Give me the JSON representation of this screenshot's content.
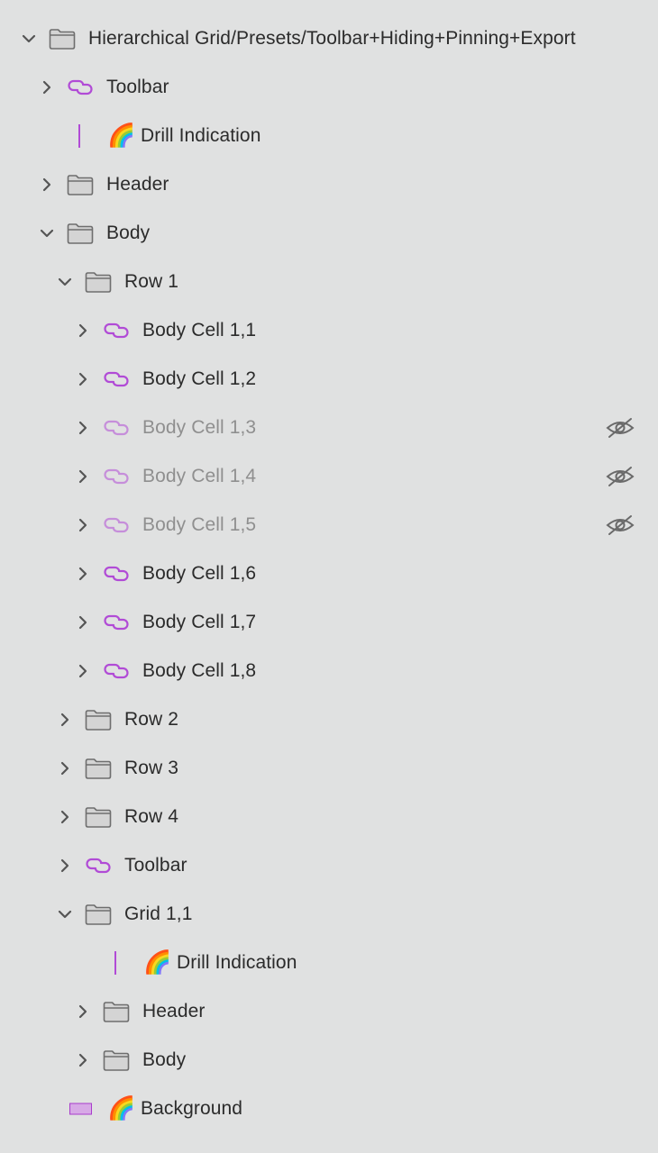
{
  "layers": [
    {
      "label": "Hierarchical Grid/Presets/Toolbar+Hiding+Pinning+Export",
      "icon": "folder-icon",
      "depth": 0,
      "expander": "expanded",
      "hidden": false
    },
    {
      "label": "Toolbar",
      "icon": "component-instance-icon",
      "depth": 1,
      "expander": "collapsed",
      "hidden": false
    },
    {
      "label": "Drill Indication",
      "icon": "rainbow-icon",
      "depth": 1,
      "expander": "none",
      "marker": "line",
      "hidden": false
    },
    {
      "label": "Header",
      "icon": "folder-icon",
      "depth": 1,
      "expander": "collapsed",
      "hidden": false
    },
    {
      "label": "Body",
      "icon": "folder-icon",
      "depth": 1,
      "expander": "expanded",
      "hidden": false
    },
    {
      "label": "Row 1",
      "icon": "folder-icon",
      "depth": 2,
      "expander": "expanded",
      "hidden": false
    },
    {
      "label": "Body Cell 1,1",
      "icon": "component-instance-icon",
      "depth": 3,
      "expander": "collapsed",
      "hidden": false
    },
    {
      "label": "Body Cell 1,2",
      "icon": "component-instance-icon",
      "depth": 3,
      "expander": "collapsed",
      "hidden": false
    },
    {
      "label": "Body Cell 1,3",
      "icon": "component-instance-icon",
      "depth": 3,
      "expander": "collapsed",
      "hidden": true
    },
    {
      "label": "Body Cell 1,4",
      "icon": "component-instance-icon",
      "depth": 3,
      "expander": "collapsed",
      "hidden": true
    },
    {
      "label": "Body Cell 1,5",
      "icon": "component-instance-icon",
      "depth": 3,
      "expander": "collapsed",
      "hidden": true
    },
    {
      "label": "Body Cell 1,6",
      "icon": "component-instance-icon",
      "depth": 3,
      "expander": "collapsed",
      "hidden": false
    },
    {
      "label": "Body Cell 1,7",
      "icon": "component-instance-icon",
      "depth": 3,
      "expander": "collapsed",
      "hidden": false
    },
    {
      "label": "Body Cell 1,8",
      "icon": "component-instance-icon",
      "depth": 3,
      "expander": "collapsed",
      "hidden": false
    },
    {
      "label": "Row 2",
      "icon": "folder-icon",
      "depth": 2,
      "expander": "collapsed",
      "hidden": false
    },
    {
      "label": "Row 3",
      "icon": "folder-icon",
      "depth": 2,
      "expander": "collapsed",
      "hidden": false
    },
    {
      "label": "Row 4",
      "icon": "folder-icon",
      "depth": 2,
      "expander": "collapsed",
      "hidden": false
    },
    {
      "label": "Toolbar",
      "icon": "component-instance-icon",
      "depth": 2,
      "expander": "collapsed",
      "hidden": false
    },
    {
      "label": "Grid 1,1",
      "icon": "folder-icon",
      "depth": 2,
      "expander": "expanded",
      "hidden": false
    },
    {
      "label": "Drill Indication",
      "icon": "rainbow-icon",
      "depth": 3,
      "expander": "none",
      "marker": "line",
      "hidden": false
    },
    {
      "label": "Header",
      "icon": "folder-icon",
      "depth": 3,
      "expander": "collapsed",
      "hidden": false
    },
    {
      "label": "Body",
      "icon": "folder-icon",
      "depth": 3,
      "expander": "collapsed",
      "hidden": false
    },
    {
      "label": "Background",
      "icon": "rainbow-icon",
      "depth": 1,
      "expander": "none",
      "marker": "swatch",
      "hidden": false
    }
  ],
  "hidden_icon": "eye-off-icon",
  "colors": {
    "background": "#e0e1e1",
    "text": "#2b2b2b",
    "text_hidden": "#8f8f8f",
    "component": "#b14bd6",
    "folder": "#6e6e6e"
  }
}
